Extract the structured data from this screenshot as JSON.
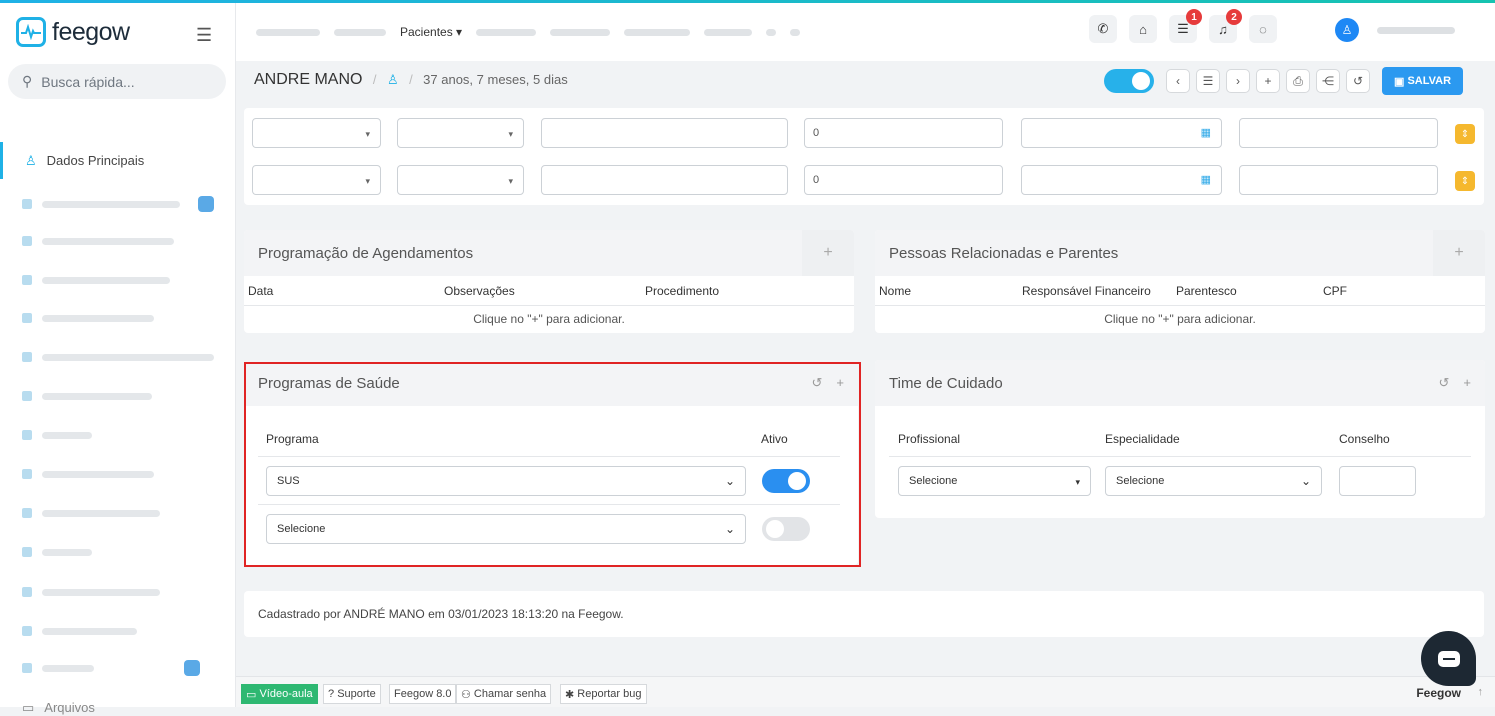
{
  "brand": "feegow",
  "search": {
    "placeholder": "Busca rápida..."
  },
  "sidebar": {
    "active_label": "Dados Principais",
    "last_label": "Arquivos"
  },
  "topnav": {
    "active_label": "Pacientes"
  },
  "topbar": {
    "badges": {
      "tasks": "1",
      "notifications": "2"
    }
  },
  "patient": {
    "name": "ANDRE MANO",
    "age": "37 anos, 7 meses, 5 dias"
  },
  "toolbar": {
    "save_label": "SALVAR"
  },
  "rows": [
    {
      "value": "0"
    },
    {
      "value": "0"
    }
  ],
  "agendamentos": {
    "title": "Programação de Agendamentos",
    "columns": [
      "Data",
      "Observações",
      "Procedimento"
    ],
    "empty": "Clique no \"+\" para adicionar."
  },
  "pessoas": {
    "title": "Pessoas Relacionadas e Parentes",
    "columns": [
      "Nome",
      "Responsável Financeiro",
      "Parentesco",
      "CPF"
    ],
    "empty": "Clique no \"+\" para adicionar."
  },
  "programas": {
    "title": "Programas de Saúde",
    "col_programa": "Programa",
    "col_ativo": "Ativo",
    "rows": [
      {
        "value": "SUS",
        "active": true
      },
      {
        "value": "Selecione",
        "active": false
      }
    ]
  },
  "time": {
    "title": "Time de Cuidado",
    "col_profissional": "Profissional",
    "col_especialidade": "Especialidade",
    "col_conselho": "Conselho",
    "profissional_value": "Selecione",
    "especialidade_value": "Selecione"
  },
  "register_note": "Cadastrado por ANDRÉ MANO em 03/01/2023 18:13:20 na Feegow.",
  "footer": {
    "video": "Vídeo-aula",
    "support": "Suporte",
    "version": "Feegow 8.0",
    "call": "Chamar senha",
    "bug": "Reportar bug",
    "brand": "Feegow"
  },
  "colors": {
    "accent": "#1fb1e6",
    "toggle_on": "#2a8ff0",
    "highlight": "#e02424",
    "warn": "#f5b82e"
  }
}
